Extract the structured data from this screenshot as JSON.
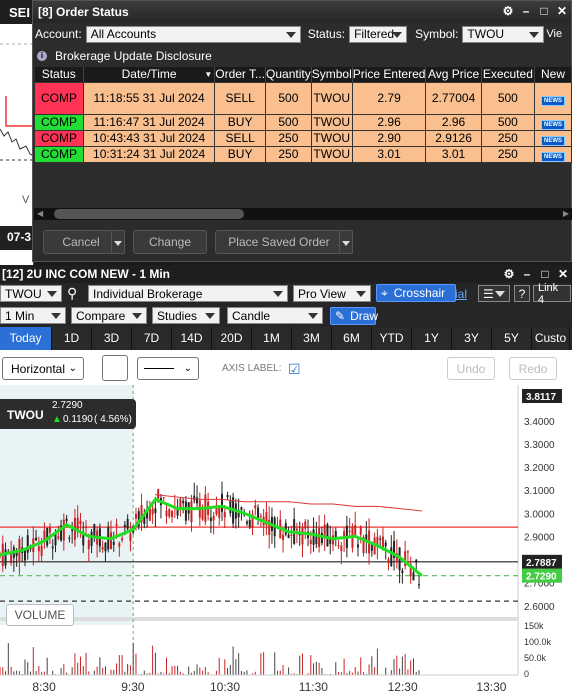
{
  "bg_chart": {
    "symbol_partial": "SEI",
    "date_partial": "07-3",
    "vol_partial": "V"
  },
  "order_window": {
    "title": "[8] Order Status",
    "account_label": "Account:",
    "account_value": "All Accounts",
    "status_label": "Status:",
    "status_value": "Filtered",
    "symbol_label": "Symbol:",
    "symbol_value": "TWOU",
    "view_partial": "Vie",
    "disclosure": "Brokerage Update Disclosure",
    "columns": [
      "Status",
      "Date/Time",
      "Order T...",
      "Quantity",
      "Symbol",
      "Price Entered",
      "Avg Price",
      "Executed",
      "New"
    ],
    "rows": [
      {
        "status": "COMP",
        "status_color": "#ff3355",
        "datetime": "11:18:55 31 Jul 2024",
        "type": "SELL",
        "qty": "500",
        "symbol": "TWOU",
        "price_entered": "2.79",
        "avg_price": "2.77004",
        "executed": "500",
        "news": "NEWS"
      },
      {
        "status": "COMP",
        "status_color": "#22dd33",
        "datetime": "11:16:47 31 Jul 2024",
        "type": "BUY",
        "qty": "500",
        "symbol": "TWOU",
        "price_entered": "2.96",
        "avg_price": "2.96",
        "executed": "500",
        "news": "NEWS"
      },
      {
        "status": "COMP",
        "status_color": "#ff3355",
        "datetime": "10:43:43 31 Jul 2024",
        "type": "SELL",
        "qty": "250",
        "symbol": "TWOU",
        "price_entered": "2.90",
        "avg_price": "2.9126",
        "executed": "250",
        "news": "NEWS"
      },
      {
        "status": "COMP",
        "status_color": "#22dd33",
        "datetime": "10:31:24 31 Jul 2024",
        "type": "BUY",
        "qty": "250",
        "symbol": "TWOU",
        "price_entered": "3.01",
        "avg_price": "3.01",
        "executed": "250",
        "news": "NEWS"
      }
    ],
    "cancel_label": "Cancel",
    "change_label": "Change",
    "place_saved_label": "Place Saved Order"
  },
  "chart_window": {
    "title": "[12] 2U INC COM NEW - 1 Min",
    "symbol": "TWOU",
    "account_mode": "Individual Brokerage",
    "view_mode": "Pro View",
    "crosshair_label": "Crosshair",
    "trial_partial": "ial",
    "link_label": "Link 4",
    "help_label": "?",
    "interval": "1 Min",
    "compare_label": "Compare",
    "studies_label": "Studies",
    "chart_style": "Candle",
    "draw_label": "Draw",
    "ranges": [
      "Today",
      "1D",
      "3D",
      "7D",
      "14D",
      "20D",
      "1M",
      "3M",
      "6M",
      "YTD",
      "1Y",
      "3Y",
      "5Y",
      "Custo"
    ],
    "active_range": "Today",
    "draw_tool": "Horizontal",
    "axis_label": "AXIS LABEL:",
    "undo_label": "Undo",
    "redo_label": "Redo",
    "volume_label": "VOLUME",
    "quote": {
      "symbol": "TWOU",
      "last": "2.7290",
      "change": "0.1190",
      "change_pct": "( 4.56%)"
    }
  },
  "chart_data": {
    "type": "line",
    "title": "",
    "x_ticks": [
      "8:30",
      "9:30",
      "10:30",
      "11:30",
      "12:30",
      "13:30"
    ],
    "y_ticks": [
      "3.4000",
      "3.3000",
      "3.2000",
      "3.1000",
      "3.0000",
      "2.9000",
      "2.8000",
      "2.7000",
      "2.6000"
    ],
    "ylim": [
      2.56,
      3.52
    ],
    "price_labels": {
      "high": "3.8117",
      "ref": "2.7887",
      "last": "2.7290"
    },
    "volume_ticks": [
      "150k",
      "100.0k",
      "50.0k",
      "0"
    ],
    "series": [
      {
        "color": "#22dd22",
        "x": [
          "8:00",
          "8:15",
          "8:30",
          "8:45",
          "9:00",
          "9:15",
          "9:30",
          "9:45",
          "10:00",
          "10:15",
          "10:30",
          "10:45",
          "11:00",
          "11:15",
          "11:30",
          "11:45",
          "12:00",
          "12:15",
          "12:30",
          "12:45"
        ],
        "values": [
          2.82,
          2.84,
          2.88,
          2.95,
          2.9,
          2.89,
          2.93,
          3.06,
          3.02,
          3.02,
          3.03,
          3.0,
          2.96,
          2.92,
          2.91,
          2.89,
          2.9,
          2.86,
          2.81,
          2.73
        ]
      },
      {
        "color": "#dd3333",
        "x": [
          "9:45",
          "10:00",
          "10:15",
          "10:30",
          "10:45",
          "11:00",
          "11:15",
          "11:30",
          "11:45",
          "12:00",
          "12:15",
          "12:30",
          "12:45"
        ],
        "values": [
          3.08,
          3.07,
          3.06,
          3.06,
          3.05,
          3.05,
          3.05,
          3.04,
          3.04,
          3.03,
          3.03,
          3.02,
          3.01
        ]
      }
    ],
    "levels": [
      {
        "value": 2.94,
        "color": "#ee3333",
        "style": "solid"
      },
      {
        "value": 2.79,
        "color": "#222222",
        "style": "solid"
      },
      {
        "value": 2.73,
        "color": "#55bb55",
        "style": "dashed"
      },
      {
        "value": 2.62,
        "color": "#333333",
        "style": "dashed"
      }
    ]
  }
}
